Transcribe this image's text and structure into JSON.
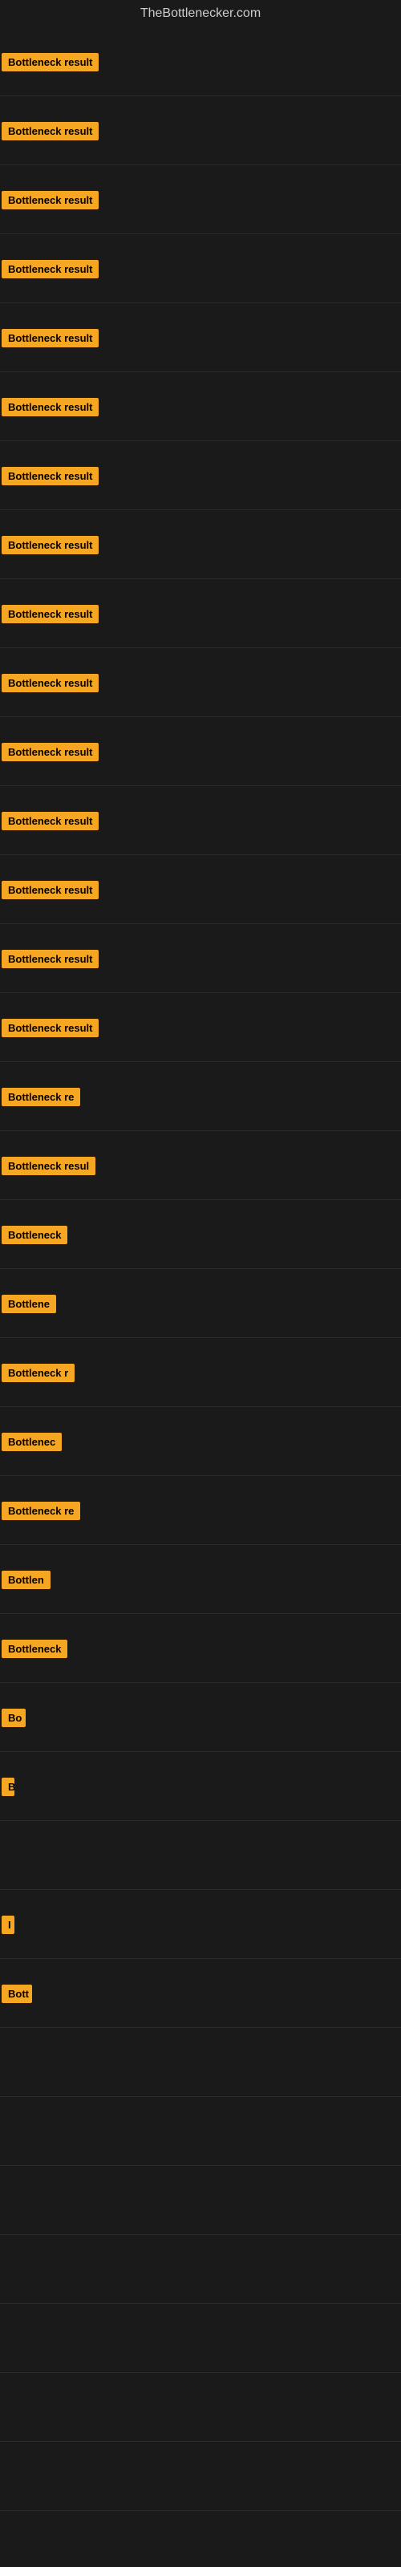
{
  "site": {
    "title": "TheBottlenecker.com"
  },
  "rows": [
    {
      "id": 1,
      "label": "Bottleneck result",
      "width": 150
    },
    {
      "id": 2,
      "label": "Bottleneck result",
      "width": 150
    },
    {
      "id": 3,
      "label": "Bottleneck result",
      "width": 150
    },
    {
      "id": 4,
      "label": "Bottleneck result",
      "width": 150
    },
    {
      "id": 5,
      "label": "Bottleneck result",
      "width": 150
    },
    {
      "id": 6,
      "label": "Bottleneck result",
      "width": 150
    },
    {
      "id": 7,
      "label": "Bottleneck result",
      "width": 150
    },
    {
      "id": 8,
      "label": "Bottleneck result",
      "width": 150
    },
    {
      "id": 9,
      "label": "Bottleneck result",
      "width": 150
    },
    {
      "id": 10,
      "label": "Bottleneck result",
      "width": 150
    },
    {
      "id": 11,
      "label": "Bottleneck result",
      "width": 150
    },
    {
      "id": 12,
      "label": "Bottleneck result",
      "width": 150
    },
    {
      "id": 13,
      "label": "Bottleneck result",
      "width": 150
    },
    {
      "id": 14,
      "label": "Bottleneck result",
      "width": 150
    },
    {
      "id": 15,
      "label": "Bottleneck result",
      "width": 150
    },
    {
      "id": 16,
      "label": "Bottleneck re",
      "width": 110
    },
    {
      "id": 17,
      "label": "Bottleneck resul",
      "width": 120
    },
    {
      "id": 18,
      "label": "Bottleneck",
      "width": 90
    },
    {
      "id": 19,
      "label": "Bottlene",
      "width": 75
    },
    {
      "id": 20,
      "label": "Bottleneck r",
      "width": 100
    },
    {
      "id": 21,
      "label": "Bottlenec",
      "width": 82
    },
    {
      "id": 22,
      "label": "Bottleneck re",
      "width": 108
    },
    {
      "id": 23,
      "label": "Bottlen",
      "width": 68
    },
    {
      "id": 24,
      "label": "Bottleneck",
      "width": 88
    },
    {
      "id": 25,
      "label": "Bo",
      "width": 30
    },
    {
      "id": 26,
      "label": "B",
      "width": 16
    },
    {
      "id": 27,
      "label": "",
      "width": 0
    },
    {
      "id": 28,
      "label": "I",
      "width": 8
    },
    {
      "id": 29,
      "label": "Bott",
      "width": 38
    },
    {
      "id": 30,
      "label": "",
      "width": 0
    },
    {
      "id": 31,
      "label": "",
      "width": 0
    },
    {
      "id": 32,
      "label": "",
      "width": 0
    },
    {
      "id": 33,
      "label": "",
      "width": 0
    },
    {
      "id": 34,
      "label": "",
      "width": 0
    },
    {
      "id": 35,
      "label": "",
      "width": 0
    },
    {
      "id": 36,
      "label": "",
      "width": 0
    }
  ]
}
